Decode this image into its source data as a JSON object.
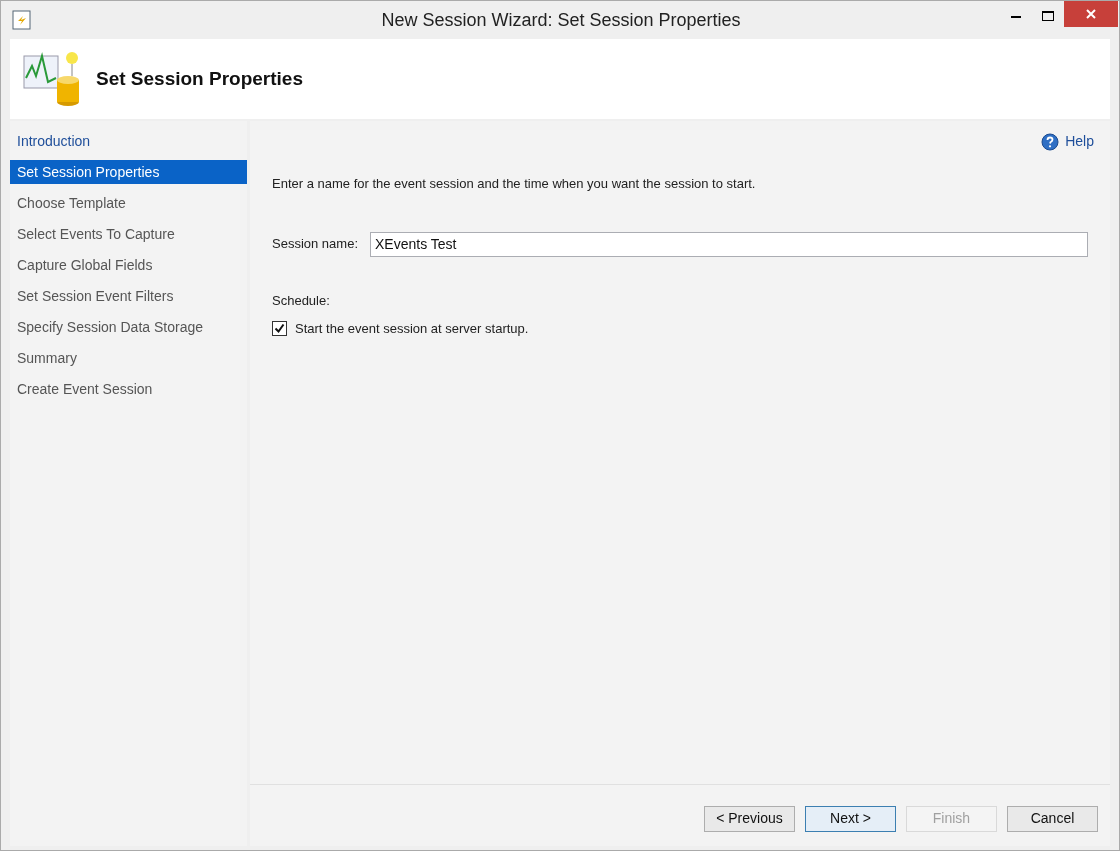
{
  "window": {
    "title": "New Session Wizard: Set Session Properties"
  },
  "header": {
    "title": "Set Session Properties"
  },
  "steps": [
    {
      "label": "Introduction",
      "selected": false,
      "visited": true
    },
    {
      "label": "Set Session Properties",
      "selected": true,
      "visited": false
    },
    {
      "label": "Choose Template",
      "selected": false,
      "visited": false
    },
    {
      "label": "Select Events To Capture",
      "selected": false,
      "visited": false
    },
    {
      "label": "Capture Global Fields",
      "selected": false,
      "visited": false
    },
    {
      "label": "Set Session Event Filters",
      "selected": false,
      "visited": false
    },
    {
      "label": "Specify Session Data Storage",
      "selected": false,
      "visited": false
    },
    {
      "label": "Summary",
      "selected": false,
      "visited": false
    },
    {
      "label": "Create Event Session",
      "selected": false,
      "visited": false
    }
  ],
  "help": {
    "label": "Help"
  },
  "instruction": "Enter a name for the event session and the time when you want the session to start.",
  "session_name": {
    "label": "Session name:",
    "value": "XEvents Test"
  },
  "schedule": {
    "label": "Schedule:",
    "checkbox": {
      "label": "Start the event session at server startup.",
      "checked": true
    }
  },
  "buttons": [
    {
      "label": "< Previous",
      "disabled": false,
      "default": false
    },
    {
      "label": "Next >",
      "disabled": false,
      "default": true
    },
    {
      "label": "Finish",
      "disabled": true,
      "default": false
    },
    {
      "label": "Cancel",
      "disabled": false,
      "default": false
    }
  ]
}
